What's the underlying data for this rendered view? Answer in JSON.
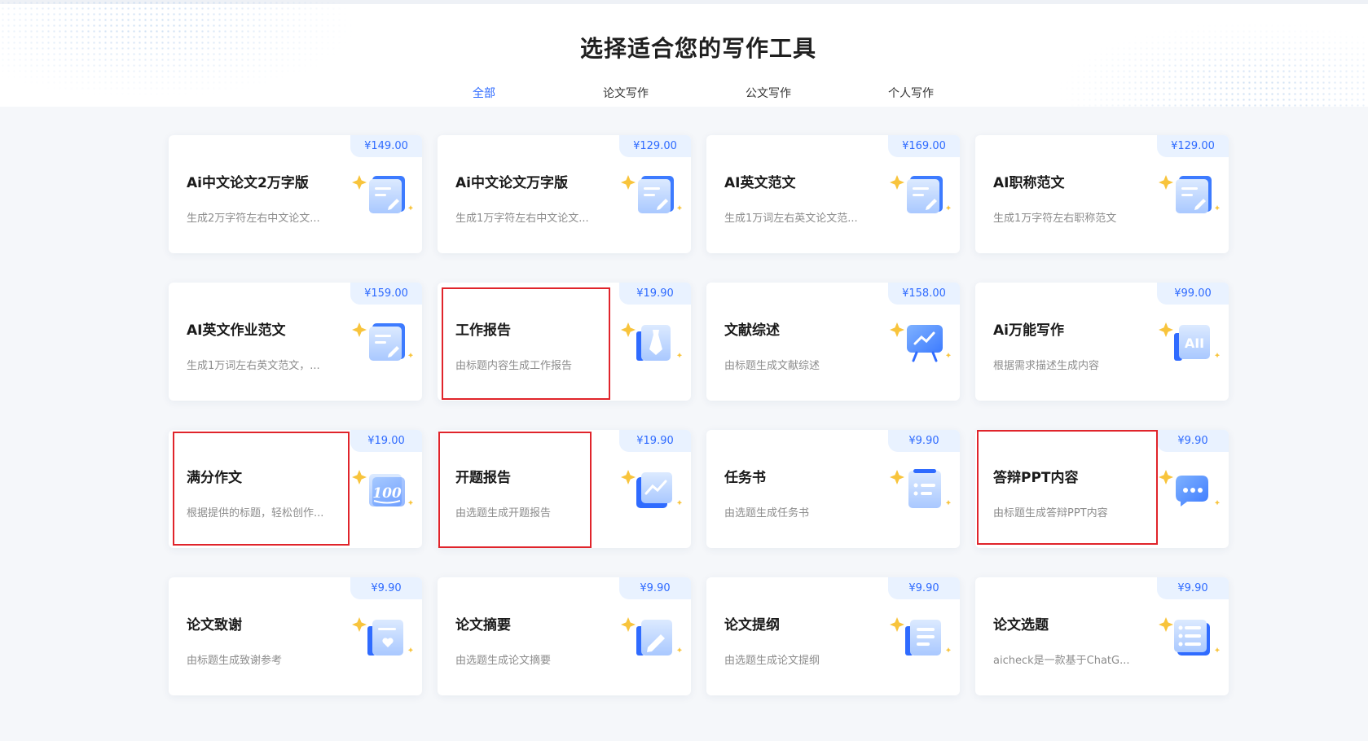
{
  "header": {
    "title": "选择适合您的写作工具",
    "tabs": [
      {
        "label": "全部",
        "active": true
      },
      {
        "label": "论文写作",
        "active": false
      },
      {
        "label": "公文写作",
        "active": false
      },
      {
        "label": "个人写作",
        "active": false
      }
    ]
  },
  "colors": {
    "accent": "#2f6bff",
    "price_bg": "#e9f2ff",
    "highlight_border": "#e0242b",
    "star": "#f8c43c"
  },
  "cards": [
    {
      "title": "Ai中文论文2万字版",
      "desc": "生成2万字符左右中文论文...",
      "price": "¥149.00",
      "icon": "document-edit-icon"
    },
    {
      "title": "Ai中文论文万字版",
      "desc": "生成1万字符左右中文论文...",
      "price": "¥129.00",
      "icon": "document-edit-icon"
    },
    {
      "title": "AI英文范文",
      "desc": "生成1万词左右英文论文范...",
      "price": "¥169.00",
      "icon": "document-edit-icon"
    },
    {
      "title": "AI职称范文",
      "desc": "生成1万字符左右职称范文",
      "price": "¥129.00",
      "icon": "document-edit-icon"
    },
    {
      "title": "AI英文作业范文",
      "desc": "生成1万词左右英文范文，...",
      "price": "¥159.00",
      "icon": "document-edit-icon"
    },
    {
      "title": "工作报告",
      "desc": "由标题内容生成工作报告",
      "price": "¥19.90",
      "icon": "tie-icon",
      "highlighted": true
    },
    {
      "title": "文献综述",
      "desc": "由标题生成文献综述",
      "price": "¥158.00",
      "icon": "presentation-chart-icon"
    },
    {
      "title": "Ai万能写作",
      "desc": "根据需求描述生成内容",
      "price": "¥99.00",
      "icon": "ai-badge-icon"
    },
    {
      "title": "满分作文",
      "desc": "根据提供的标题，轻松创作...",
      "price": "¥19.00",
      "icon": "score-100-icon",
      "highlighted": true
    },
    {
      "title": "开题报告",
      "desc": "由选题生成开题报告",
      "price": "¥19.90",
      "icon": "line-chart-icon",
      "highlighted": true
    },
    {
      "title": "任务书",
      "desc": "由选题生成任务书",
      "price": "¥9.90",
      "icon": "checklist-icon"
    },
    {
      "title": "答辩PPT内容",
      "desc": "由标题生成答辩PPT内容",
      "price": "¥9.90",
      "icon": "chat-bubble-icon",
      "highlighted": true
    },
    {
      "title": "论文致谢",
      "desc": "由标题生成致谢参考",
      "price": "¥9.90",
      "icon": "heart-list-icon"
    },
    {
      "title": "论文摘要",
      "desc": "由选题生成论文摘要",
      "price": "¥9.90",
      "icon": "pencil-icon"
    },
    {
      "title": "论文提纲",
      "desc": "由选题生成论文提纲",
      "price": "¥9.90",
      "icon": "outline-icon"
    },
    {
      "title": "论文选题",
      "desc": "aicheck是一款基于ChatG...",
      "price": "¥9.90",
      "icon": "list-icon"
    }
  ]
}
